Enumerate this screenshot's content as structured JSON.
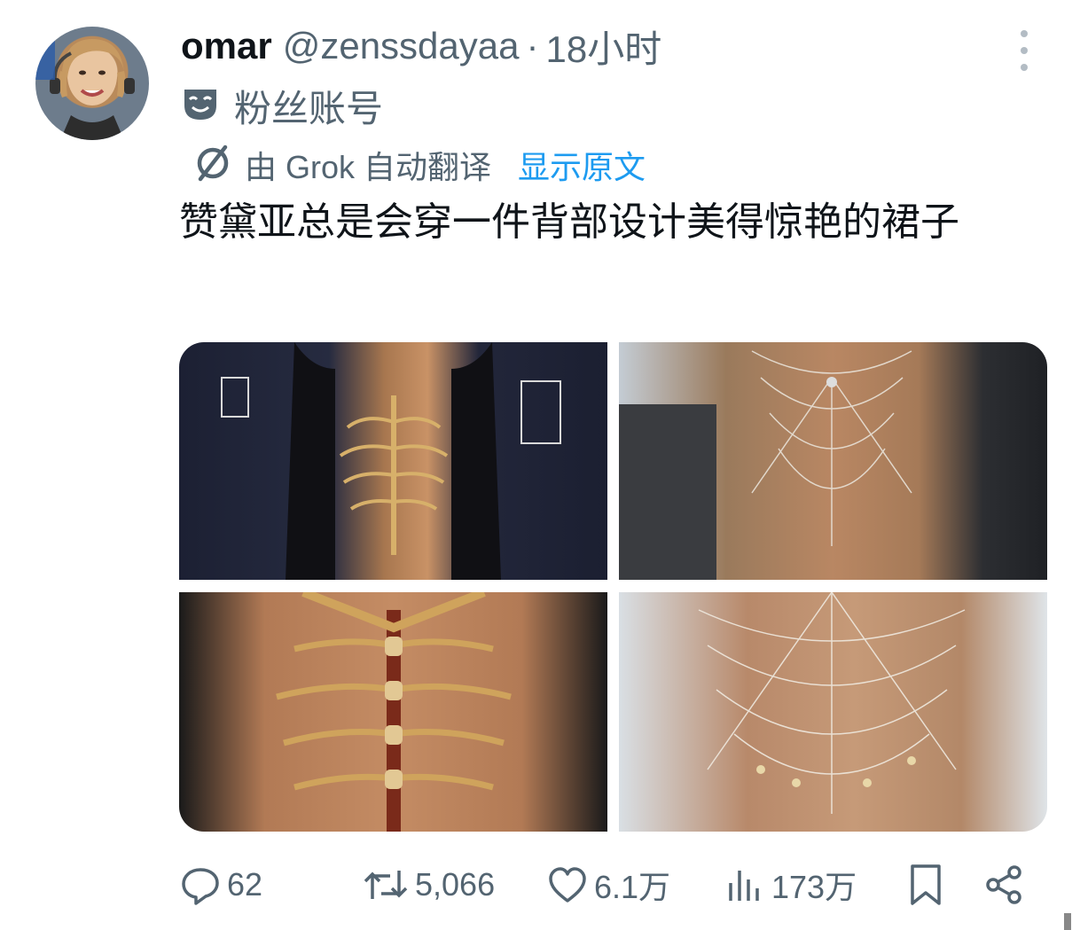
{
  "author": {
    "name": "omar",
    "handle": "@zenssdayaa",
    "separator": "·",
    "time": "18小时",
    "account_label": "粉丝账号",
    "account_label_icon": "mask-icon"
  },
  "translation": {
    "text": "由 Grok 自动翻译",
    "show_original": "显示原文",
    "icon": "grok-icon"
  },
  "tweet": {
    "text": "赞黛亚总是会穿一件背部设计美得惊艳的裙子"
  },
  "media": {
    "count": 4,
    "items": [
      "photo-1",
      "photo-2",
      "photo-3",
      "photo-4"
    ]
  },
  "actions": {
    "replies": "62",
    "reposts": "5,066",
    "likes": "6.1万",
    "views": "173万"
  },
  "colors": {
    "text": "#0f1419",
    "secondary": "#536471",
    "link": "#1d9bf0"
  }
}
